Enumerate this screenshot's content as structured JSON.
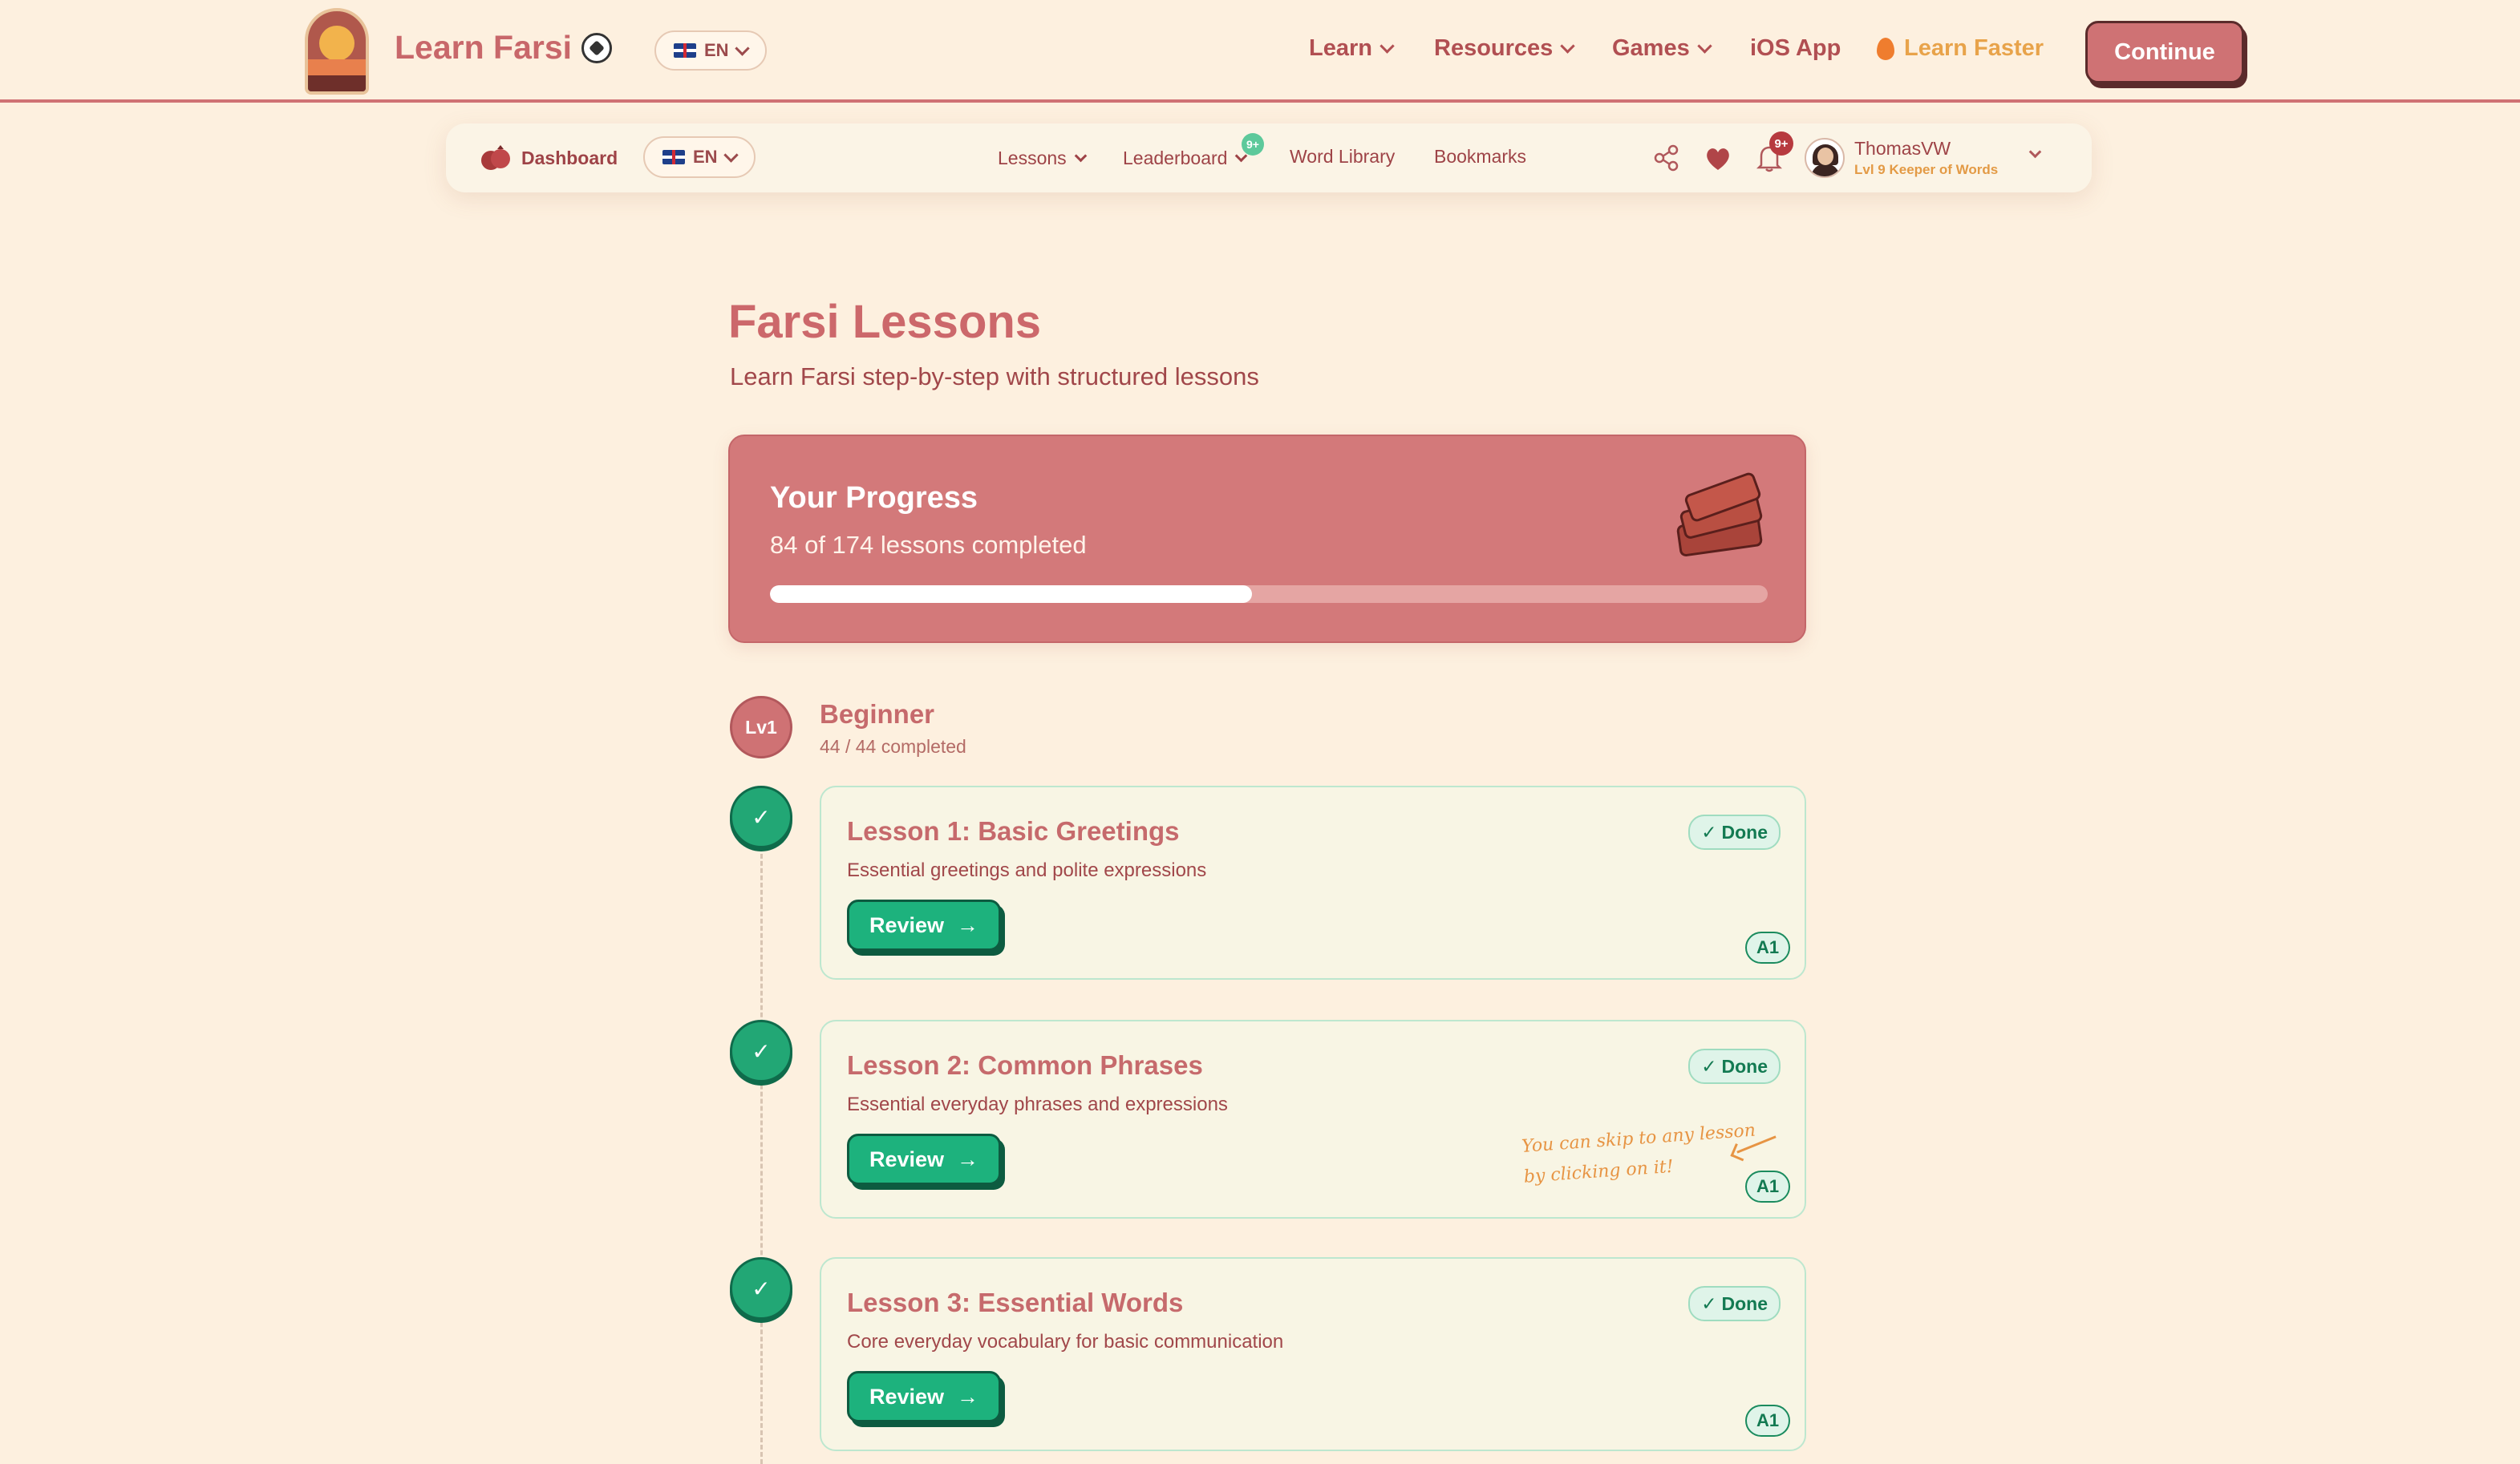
{
  "header": {
    "brand": "Learn Farsi",
    "language": "EN",
    "nav": [
      {
        "label": "Learn"
      },
      {
        "label": "Resources"
      },
      {
        "label": "Games"
      },
      {
        "label": "iOS App"
      }
    ],
    "learn_faster": "Learn Faster",
    "continue": "Continue"
  },
  "subnav": {
    "dashboard": "Dashboard",
    "language": "EN",
    "lessons": "Lessons",
    "leaderboard": "Leaderboard",
    "leaderboard_badge": "9+",
    "word_library": "Word Library",
    "bookmarks": "Bookmarks",
    "notif_badge": "9+",
    "username": "ThomasVW",
    "user_level": "Lvl 9 Keeper of Words"
  },
  "page": {
    "title": "Farsi Lessons",
    "subtitle": "Learn Farsi step-by-step with structured lessons"
  },
  "progress": {
    "title": "Your Progress",
    "text": "84 of 174 lessons completed",
    "completed": 84,
    "total": 174
  },
  "level": {
    "badge": "Lv1",
    "name": "Beginner",
    "completed": "44 / 44 completed"
  },
  "lessons": [
    {
      "title": "Lesson 1: Basic Greetings",
      "description": "Essential greetings and polite expressions",
      "status": "Done",
      "button": "Review",
      "level": "A1"
    },
    {
      "title": "Lesson 2: Common Phrases",
      "description": "Essential everyday phrases and expressions",
      "status": "Done",
      "button": "Review",
      "level": "A1"
    },
    {
      "title": "Lesson 3: Essential Words",
      "description": "Core everyday vocabulary for basic communication",
      "status": "Done",
      "button": "Review",
      "level": "A1"
    }
  ],
  "hint": {
    "line1": "You can skip to any lesson",
    "line2": "by clicking on it!"
  },
  "colors": {
    "background": "#fdf0df",
    "brand": "#cf7274",
    "success": "#1db27d",
    "accent": "#e8a34a"
  },
  "icons": [
    "logo-icon",
    "soccer-ball-icon",
    "flag-uk-icon",
    "flame-icon",
    "pomegranate-icon",
    "share-icon",
    "heart-icon",
    "bell-icon",
    "books-icon",
    "check-icon",
    "arrow-right-icon"
  ]
}
